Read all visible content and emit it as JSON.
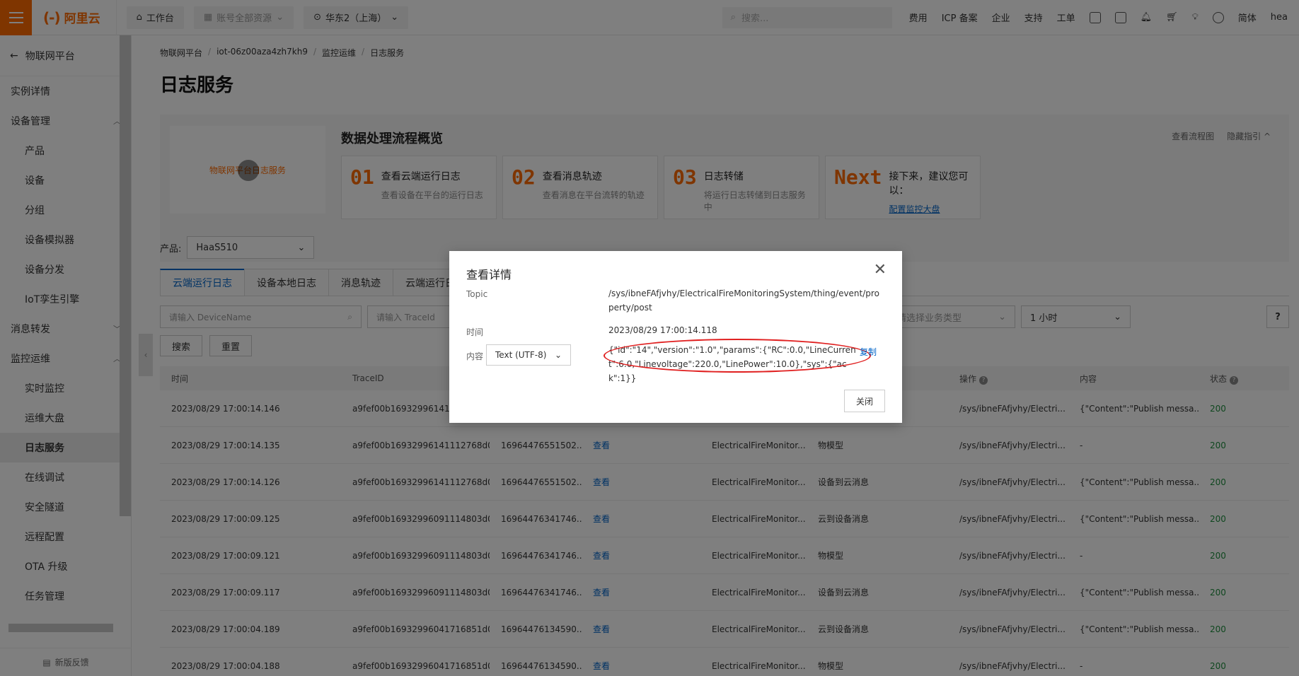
{
  "topbar": {
    "logo_text": "阿里云",
    "workbench": "工作台",
    "resources": "账号全部资源",
    "region": "华东2（上海）",
    "search_placeholder": "搜索...",
    "links": [
      "费用",
      "ICP 备案",
      "企业",
      "支持",
      "工单"
    ],
    "lang": "简体",
    "user": "hea"
  },
  "sidebar": {
    "back_label": "物联网平台",
    "items": [
      {
        "label": "实例详情",
        "sub": false
      },
      {
        "label": "设备管理",
        "sub": false,
        "chev": "︿"
      },
      {
        "label": "产品",
        "sub": true
      },
      {
        "label": "设备",
        "sub": true
      },
      {
        "label": "分组",
        "sub": true
      },
      {
        "label": "设备模拟器",
        "sub": true
      },
      {
        "label": "设备分发",
        "sub": true
      },
      {
        "label": "IoT孪生引擎",
        "sub": true
      },
      {
        "label": "消息转发",
        "sub": false,
        "chev": "﹀"
      },
      {
        "label": "监控运维",
        "sub": false,
        "chev": "︿"
      },
      {
        "label": "实时监控",
        "sub": true
      },
      {
        "label": "运维大盘",
        "sub": true
      },
      {
        "label": "日志服务",
        "sub": true,
        "active": true
      },
      {
        "label": "在线调试",
        "sub": true
      },
      {
        "label": "安全隧道",
        "sub": true
      },
      {
        "label": "远程配置",
        "sub": true
      },
      {
        "label": "OTA 升级",
        "sub": true
      },
      {
        "label": "任务管理",
        "sub": true
      }
    ],
    "feedback": "新版反馈"
  },
  "breadcrumb": [
    "物联网平台",
    "iot-06z00aza4zh7kh9",
    "监控运维",
    "日志服务"
  ],
  "page_title": "日志服务",
  "guide": {
    "video_label": "物联网平台日志服务",
    "title": "数据处理流程概览",
    "link_flow": "查看流程图",
    "link_hide": "隐藏指引",
    "steps": [
      {
        "num": "01",
        "title": "查看云端运行日志",
        "desc": "查看设备在平台的运行日志"
      },
      {
        "num": "02",
        "title": "查看消息轨迹",
        "desc": "查看消息在平台流转的轨迹"
      },
      {
        "num": "03",
        "title": "日志转储",
        "desc": "将运行日志转储到日志服务中"
      },
      {
        "num": "Next",
        "title": "接下来，建议您可以：",
        "desc": "配置监控大盘"
      }
    ]
  },
  "product": {
    "label": "产品:",
    "value": "HaaS510"
  },
  "tabs": [
    "云端运行日志",
    "设备本地日志",
    "消息轨迹",
    "云端运行日"
  ],
  "filters": {
    "device_placeholder": "请输入 DeviceName",
    "trace_placeholder": "请输入 TraceId",
    "biz_placeholder": "请选择业务类型",
    "time_range": "1 小时",
    "help": "?"
  },
  "buttons": {
    "search": "搜索",
    "reset": "重置"
  },
  "table": {
    "headers": [
      "时间",
      "TraceID",
      "",
      "",
      "",
      "",
      "操作",
      "内容",
      "状态"
    ],
    "rows": [
      [
        "2023/08/29 17:00:14.146",
        "a9fef00b16932996141112768d0067",
        "",
        "",
        "",
        "",
        "/sys/ibneFAfjvhy/Electri...",
        "{\"Content\":\"Publish messa...",
        "200"
      ],
      [
        "2023/08/29 17:00:14.135",
        "a9fef00b16932996141112768d0067",
        "16964476551502...",
        "查看",
        "ElectricalFireMonitor...",
        "物模型",
        "/sys/ibneFAfjvhy/Electri...",
        "-",
        "200"
      ],
      [
        "2023/08/29 17:00:14.126",
        "a9fef00b16932996141112768d0067",
        "16964476551502...",
        "查看",
        "ElectricalFireMonitor...",
        "设备到云消息",
        "/sys/ibneFAfjvhy/Electri...",
        "{\"Content\":\"Publish messa...",
        "200"
      ],
      [
        "2023/08/29 17:00:09.125",
        "a9fef00b16932996091114803d0067",
        "16964476341746...",
        "查看",
        "ElectricalFireMonitor...",
        "云到设备消息",
        "/sys/ibneFAfjvhy/Electri...",
        "{\"Content\":\"Publish messa...",
        "200"
      ],
      [
        "2023/08/29 17:00:09.121",
        "a9fef00b16932996091114803d0067",
        "16964476341746...",
        "查看",
        "ElectricalFireMonitor...",
        "物模型",
        "/sys/ibneFAfjvhy/Electri...",
        "-",
        "200"
      ],
      [
        "2023/08/29 17:00:09.117",
        "a9fef00b16932996091114803d0067",
        "16964476341746...",
        "查看",
        "ElectricalFireMonitor...",
        "设备到云消息",
        "/sys/ibneFAfjvhy/Electri...",
        "{\"Content\":\"Publish messa...",
        "200"
      ],
      [
        "2023/08/29 17:00:04.189",
        "a9fef00b16932996041716851d0067",
        "16964476134590...",
        "查看",
        "ElectricalFireMonitor...",
        "云到设备消息",
        "/sys/ibneFAfjvhy/Electri...",
        "{\"Content\":\"Publish messa...",
        "200"
      ],
      [
        "2023/08/29 17:00:04.188",
        "a9fef00b16932996041716851d0067",
        "16964476134590...",
        "查看",
        "ElectricalFireMonitor...",
        "物模型",
        "/sys/ibneFAfjvhy/Electri...",
        "-",
        "200"
      ]
    ]
  },
  "modal": {
    "title": "查看详情",
    "topic_label": "Topic",
    "topic_value": "/sys/ibneFAfjvhy/ElectricalFireMonitoringSystem/thing/event/property/post",
    "time_label": "时间",
    "time_value": "2023/08/29 17:00:14.118",
    "content_label": "内容",
    "encoding": "Text (UTF-8)",
    "content_value": "{\"id\":\"14\",\"version\":\"1.0\",\"params\":{\"RC\":0.0,\"LineCurrent\":6.0,\"Linevoltage\":220.0,\"LinePower\":10.0},\"sys\":{\"ack\":1}}",
    "copy": "复制",
    "close": "关闭"
  },
  "colors": {
    "brand": "#ff6a00",
    "link": "#0064c8",
    "success": "#1e8e3e",
    "highlight": "#e02020"
  }
}
